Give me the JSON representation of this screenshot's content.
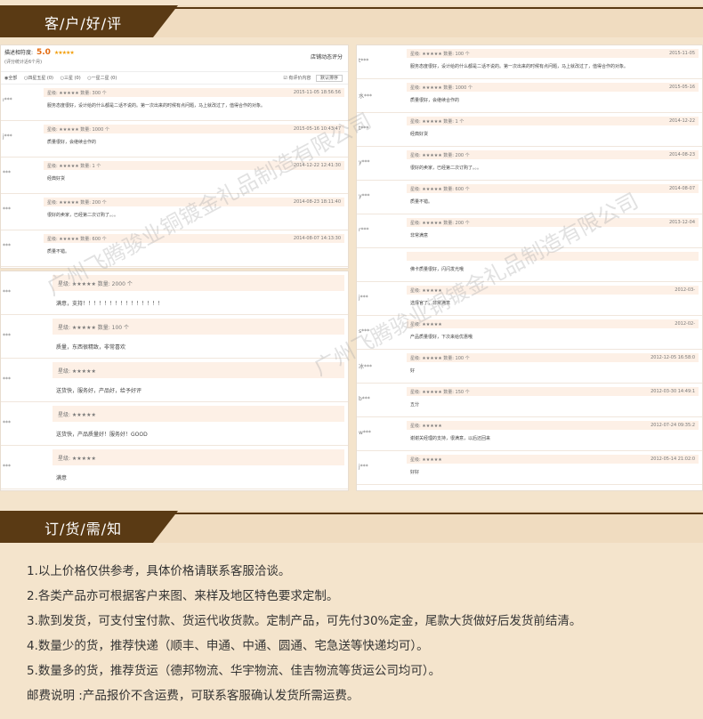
{
  "sections": {
    "reviews_title": "客/户/好/评",
    "ordering_title": "订/货/需/知"
  },
  "review_panel": {
    "rating_label": "描述相符度:",
    "score": "5.0",
    "stars": "★★★★★",
    "note": "(评分统计近6个月)",
    "dynamic_label": "店铺动态评分",
    "filters": [
      "◉全部",
      "○四星五星 (0)",
      "○三星 (0)",
      "○一星二星 (0)"
    ],
    "with_content": "☑ 有评价内容",
    "sort_label": "默认排序"
  },
  "reviews_a": [
    {
      "user": "ı***",
      "meta": "星级: ★★★★★  数量: 300 个",
      "date": "2015-11-05 18:56:56",
      "text": "服务态度很好，设计给的什么都是二话不说的。第一次出来的时候有点问题，马上就改过了，值得合作的对象。"
    },
    {
      "user": "j***",
      "meta": "星级: ★★★★★  数量: 1000 个",
      "date": "2015-05-16 10:43:47",
      "text": "质量很好，会继续合作的"
    },
    {
      "user": "***",
      "meta": "星级: ★★★★★  数量: 1 个",
      "date": "2014-12-22 12:41:30",
      "text": "经典好货"
    },
    {
      "user": "***",
      "meta": "星级: ★★★★★  数量: 200 个",
      "date": "2014-08-23 18:11:40",
      "text": "很好的卖家，已经第二次订购了。。。"
    },
    {
      "user": "***",
      "meta": "星级: ★★★★★  数量: 600 个",
      "date": "2014-08-07 14:13:30",
      "text": "质量不错。"
    }
  ],
  "reviews_b": [
    {
      "user": "***",
      "meta": "星级: ★★★★★  数量: 2000 个",
      "text": "满意，支持！！！！！！！！！！！！！！！"
    },
    {
      "user": "***",
      "meta": "星级: ★★★★★  数量: 100 个",
      "text": "质量，东西很精致，非常喜欢"
    },
    {
      "user": "***",
      "meta": "星级: ★★★★★",
      "text": "送货快，服务好，产品好，给予好评"
    },
    {
      "user": "***",
      "meta": "星级: ★★★★★",
      "text": "送货快，产品质量好！服务好！GOOD"
    },
    {
      "user": "***",
      "meta": "星级: ★★★★★",
      "text": "满意"
    }
  ],
  "reviews_c": [
    {
      "user": "t***",
      "meta": "星级: ★★★★★  数量: 100 个",
      "date": "2015-11-05",
      "text": "服务态度很好，设计给的什么都是二话不说的。第一次出来的时候有点问题，马上就改过了，值得合作的对象。"
    },
    {
      "user": "水***",
      "meta": "星级: ★★★★★  数量: 1000 个",
      "date": "2015-05-16",
      "text": "质量很好，会继续合作的"
    },
    {
      "user": "t***",
      "meta": "星级: ★★★★★  数量: 1 个",
      "date": "2014-12-22",
      "text": "经典好货"
    },
    {
      "user": "y***",
      "meta": "星级: ★★★★★  数量: 200 个",
      "date": "2014-08-23",
      "text": "很好的卖家，已经第二次订购了。。。"
    },
    {
      "user": "y***",
      "meta": "星级: ★★★★★  数量: 600 个",
      "date": "2014-08-07",
      "text": "质量不错。"
    },
    {
      "user": "r***",
      "meta": "星级: ★★★★★  数量: 200 个",
      "date": "2013-12-04",
      "text": "非常满意"
    },
    {
      "user": "",
      "meta": "",
      "date": "",
      "text": "佛卡质量很好，闪闪发光哦"
    },
    {
      "user": "j***",
      "meta": "星级: ★★★★★",
      "date": "2012-03-",
      "text": "选择官了，非常满意"
    },
    {
      "user": "s***",
      "meta": "星级: ★★★★★",
      "date": "2012-02-",
      "text": "产品质量很好，下次来给优惠哦"
    },
    {
      "user": "冰***",
      "meta": "星级: ★★★★★  数量: 100 个",
      "date": "2012-12-05 16:58:0",
      "text": "好"
    },
    {
      "user": "b***",
      "meta": "星级: ★★★★★  数量: 150 个",
      "date": "2012-03-30 14:49:1",
      "text": "五分"
    },
    {
      "user": "w***",
      "meta": "星级: ★★★★★",
      "date": "2012-07-24 09:35:2",
      "text": "谢谢关经理的支持，很满意，以后还回来"
    },
    {
      "user": "j***",
      "meta": "星级: ★★★★★",
      "date": "2012-05-14 21:02:0",
      "text": "好好"
    }
  ],
  "watermark": "广州飞腾骏业铜镀金礼品制造有限公司",
  "notes": [
    "1.以上价格仅供参考，具体价格请联系客服洽谈。",
    "2.各类产品亦可根据客户来图、来样及地区特色要求定制。",
    "3.款到发货，可支付宝付款、货运代收货款。定制产品，可先付30%定金，尾款大货做好后发货前结清。",
    "4.数量少的货，推荐快递（顺丰、申通、中通、圆通、宅急送等快递均可）。",
    "5.数量多的货，推荐货运（德邦物流、华宇物流、佳吉物流等货运公司均可）。",
    "邮费说明 :产品报价不含运费，可联系客服确认发货所需运费。"
  ]
}
